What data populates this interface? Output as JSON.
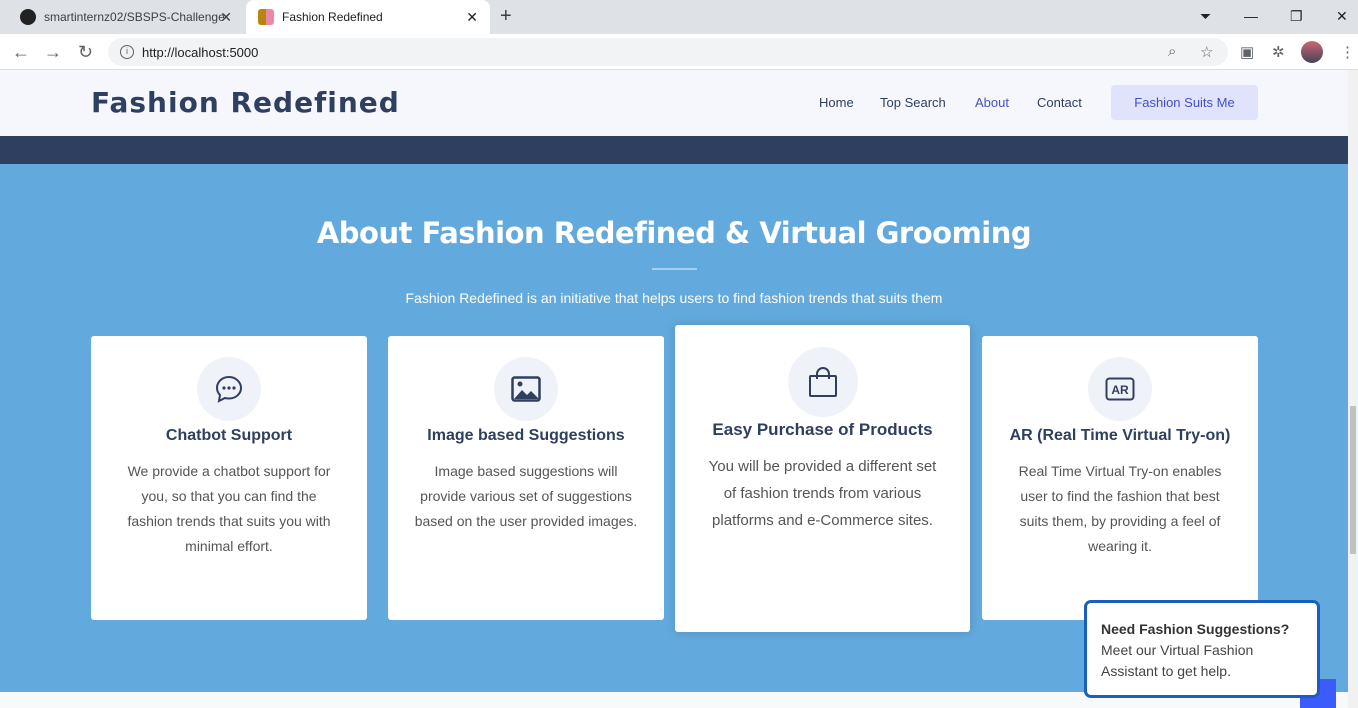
{
  "browser": {
    "tabs": [
      {
        "title": "smartinternz02/SBSPS-Challenge",
        "icon": "github-icon",
        "active": false
      },
      {
        "title": "Fashion Redefined",
        "icon": "fashion-favicon-icon",
        "active": true
      }
    ],
    "url": "http://localhost:5000"
  },
  "header": {
    "brand": "Fashion Redefined",
    "menu": [
      {
        "label": "Home"
      },
      {
        "label": "Top Search"
      },
      {
        "label": "About",
        "active": true
      },
      {
        "label": "Contact"
      }
    ],
    "cta": "Fashion Suits Me"
  },
  "about": {
    "title": "About Fashion Redefined & Virtual Grooming",
    "subtitle": "Fashion Redefined is an initiative that helps users to find fashion trends that suits them",
    "cards": [
      {
        "icon": "chat-dots-icon",
        "title": "Chatbot Support",
        "text": "We provide a chatbot support for you, so that you can find the fashion trends that suits you with minimal effort."
      },
      {
        "icon": "image-icon",
        "title": "Image based Suggestions",
        "text": "Image based suggestions will provide various set of suggestions based on the user provided images."
      },
      {
        "icon": "shopping-bag-icon",
        "title": "Easy Purchase of Products",
        "text": "You will be provided a different set of fashion trends from various platforms and e-Commerce sites."
      },
      {
        "icon": "ar-icon",
        "title": "AR (Real Time Virtual Try-on)",
        "text": "Real Time Virtual Try-on enables user to find the fashion that best suits them, by providing a feel of wearing it."
      }
    ]
  },
  "chat_popup": {
    "title": "Need Fashion Suggestions?",
    "text": "Meet our Virtual Fashion Assistant to get help."
  },
  "colors": {
    "section_bg": "#62a9dd",
    "brand": "#2f3f5f",
    "accent": "#4350c8",
    "popup_border": "#1a5fbf"
  }
}
